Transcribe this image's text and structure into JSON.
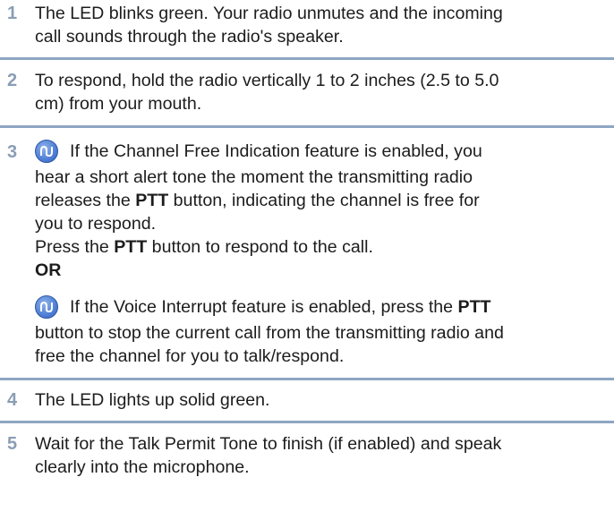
{
  "steps": [
    {
      "number": "1",
      "lines": [
        "The LED blinks green. Your radio unmutes and the incoming",
        "call sounds through the radio's speaker."
      ]
    },
    {
      "number": "2",
      "lines": [
        "To respond, hold the radio vertically 1 to 2 inches (2.5 to 5.0",
        "cm) from your mouth."
      ]
    },
    {
      "number": "3",
      "channel_free": {
        "icon": "feature-icon",
        "first_line": "If the Channel Free Indication feature is enabled, you",
        "line2": "hear a short alert tone the moment the transmitting radio",
        "line3_pre": "releases the ",
        "ptt": "PTT",
        "line3_post": " button, indicating the channel is free for",
        "line4": "you to respond.",
        "press_pre": "Press the ",
        "press_post": " button to respond to the call."
      },
      "or_label": "OR",
      "voice_interrupt": {
        "icon": "feature-icon",
        "first_line_pre": "If the Voice Interrupt feature is enabled, press the ",
        "ptt": "PTT",
        "line2": "button to stop the current call from the transmitting radio and",
        "line3": "free the channel for you to talk/respond."
      }
    },
    {
      "number": "4",
      "lines": [
        "The LED lights up solid green."
      ]
    },
    {
      "number": "5",
      "lines": [
        "Wait for the Talk Permit Tone to finish (if enabled) and speak",
        "clearly into the microphone."
      ]
    }
  ]
}
